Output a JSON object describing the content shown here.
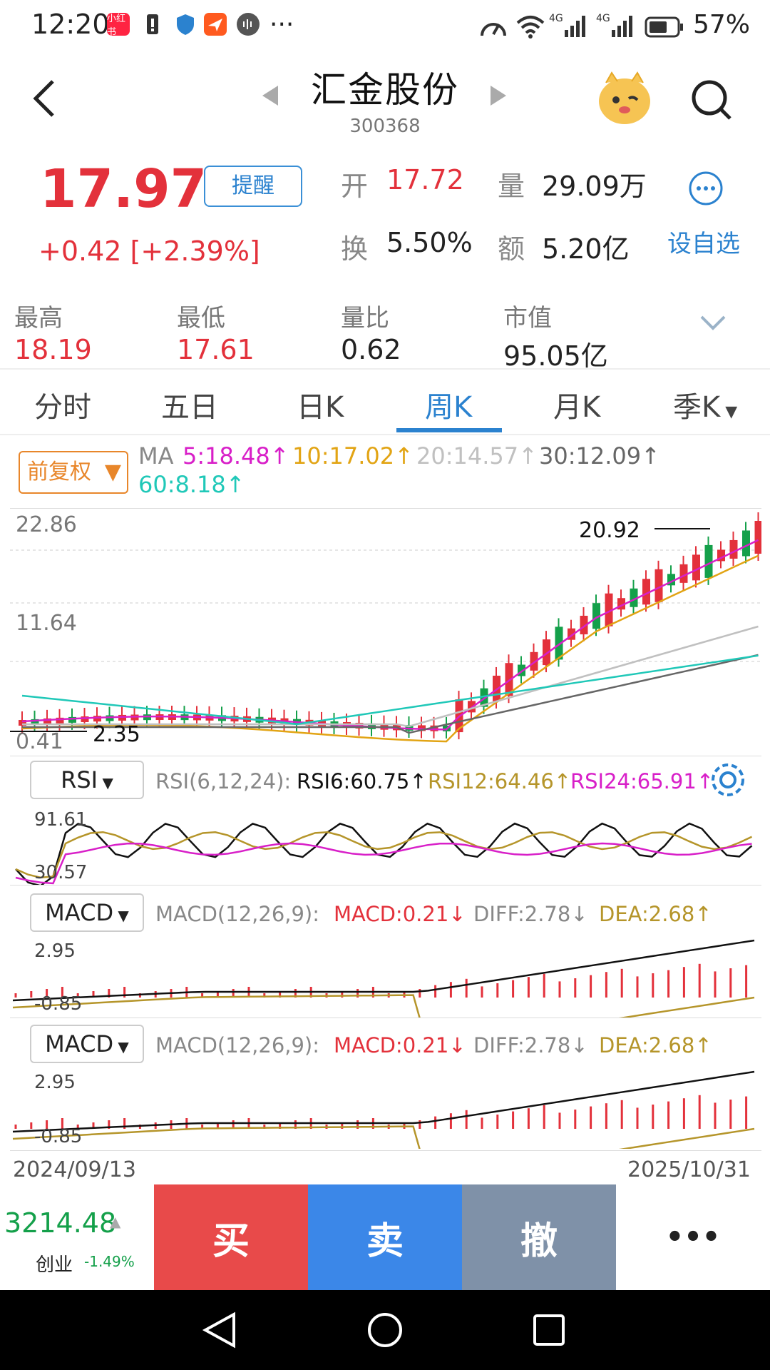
{
  "status_bar": {
    "time": "12:20",
    "app_icons": [
      "xiaohongshu-icon",
      "battery-alert-icon",
      "shield-icon",
      "plane-icon",
      "audio-icon"
    ],
    "more": "···",
    "network": "4G",
    "battery": "57%"
  },
  "header": {
    "title": "汇金股份",
    "code": "300368"
  },
  "quote": {
    "price": "17.97",
    "change": "+0.42",
    "change_pct": "[+2.39%]",
    "remind_label": "提醒",
    "open_label": "开",
    "open_value": "17.72",
    "volume_label": "量",
    "volume_value": "29.09万",
    "turnover_label": "换",
    "turnover_value": "5.50%",
    "amount_label": "额",
    "amount_value": "5.20亿",
    "add_label": "设自选"
  },
  "stats": [
    {
      "label": "最高",
      "value": "18.19"
    },
    {
      "label": "最低",
      "value": "17.61"
    },
    {
      "label": "量比",
      "value": "0.62"
    },
    {
      "label": "市值",
      "value": "95.05亿"
    }
  ],
  "tabs": [
    "分时",
    "五日",
    "日K",
    "周K",
    "月K",
    "季K"
  ],
  "active_tab": "周K",
  "ma_panel": {
    "adjust_label": "前复权",
    "ma_label": "MA",
    "ma5": "5:18.48",
    "ma10": "10:17.02",
    "ma20": "20:14.57",
    "ma30": "30:12.09",
    "ma60": "60:8.18",
    "colors": {
      "ma5": "#d81fc8",
      "ma10": "#e2a414",
      "ma20": "#c0c0c0",
      "ma30": "#666666",
      "ma60": "#20c8b8"
    }
  },
  "chart_data": {
    "type": "candlestick",
    "y_ticks": [
      "22.86",
      "11.64",
      "0.41"
    ],
    "high_marker": "20.92",
    "low_marker": "2.35",
    "x_start": "2024/09/13",
    "x_end": "2025/10/31"
  },
  "rsi": {
    "selector": "RSI",
    "params": "RSI(6,12,24):",
    "rsi6": "RSI6:60.75",
    "rsi12": "RSI12:64.46",
    "rsi24": "RSI24:65.91",
    "y_top": "91.61",
    "y_bottom": "30.57"
  },
  "macd1": {
    "selector": "MACD",
    "params": "MACD(12,26,9):",
    "macd": "MACD:0.21",
    "diff": "DIFF:2.78",
    "dea": "DEA:2.68",
    "y_top": "2.95",
    "y_bottom": "-0.85"
  },
  "macd2": {
    "selector": "MACD",
    "params": "MACD(12,26,9):",
    "macd": "MACD:0.21",
    "diff": "DIFF:2.78",
    "dea": "DEA:2.68",
    "y_top": "2.95",
    "y_bottom": "-0.85"
  },
  "bottom": {
    "index_value": "3214.48",
    "index_name": "创业",
    "index_change": "-1.49%",
    "buy": "买",
    "sell": "卖",
    "cancel": "撤",
    "more": "•••"
  }
}
